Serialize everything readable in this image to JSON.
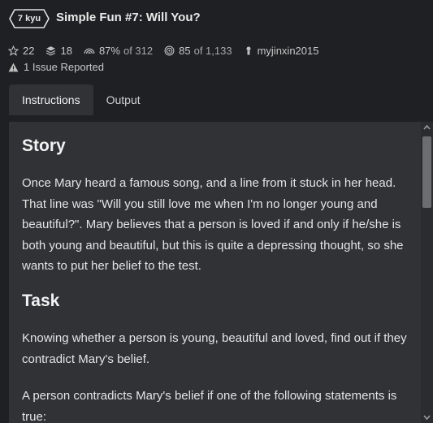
{
  "kata": {
    "rank": "7 kyu",
    "title": "Simple Fun #7: Will You?"
  },
  "stats": {
    "stars": "22",
    "collections": "18",
    "satisfaction": "87%",
    "satisfaction_of": "of 312",
    "completed": "85",
    "completed_of": "of 1,133",
    "author": "myjinxin2015"
  },
  "issues": "1 Issue Reported",
  "tabs": [
    {
      "label": "Instructions",
      "active": true
    },
    {
      "label": "Output",
      "active": false
    }
  ],
  "description": {
    "story_heading": "Story",
    "story_text": "Once Mary heard a famous song, and a line from it stuck in her head. That line was \"Will you still love me when I'm no longer young and beautiful?\". Mary believes that a person is loved if and only if he/she is both young and beautiful, but this is quite a depressing thought, so she wants to put her belief to the test.",
    "task_heading": "Task",
    "task_text": "Knowing whether a person is young, beautiful and loved, find out if they contradict Mary's belief.",
    "contradict_text": "A person contradicts Mary's belief if one of the following statements is true:"
  },
  "icons": {
    "stars": "star-icon",
    "collections": "stack-icon",
    "satisfaction": "rainbow-icon",
    "completed": "target-icon",
    "author": "user-icon",
    "issues": "warning-icon"
  },
  "colors": {
    "background": "#1f2023",
    "panel": "#303236",
    "text": "#e6e6e6"
  }
}
